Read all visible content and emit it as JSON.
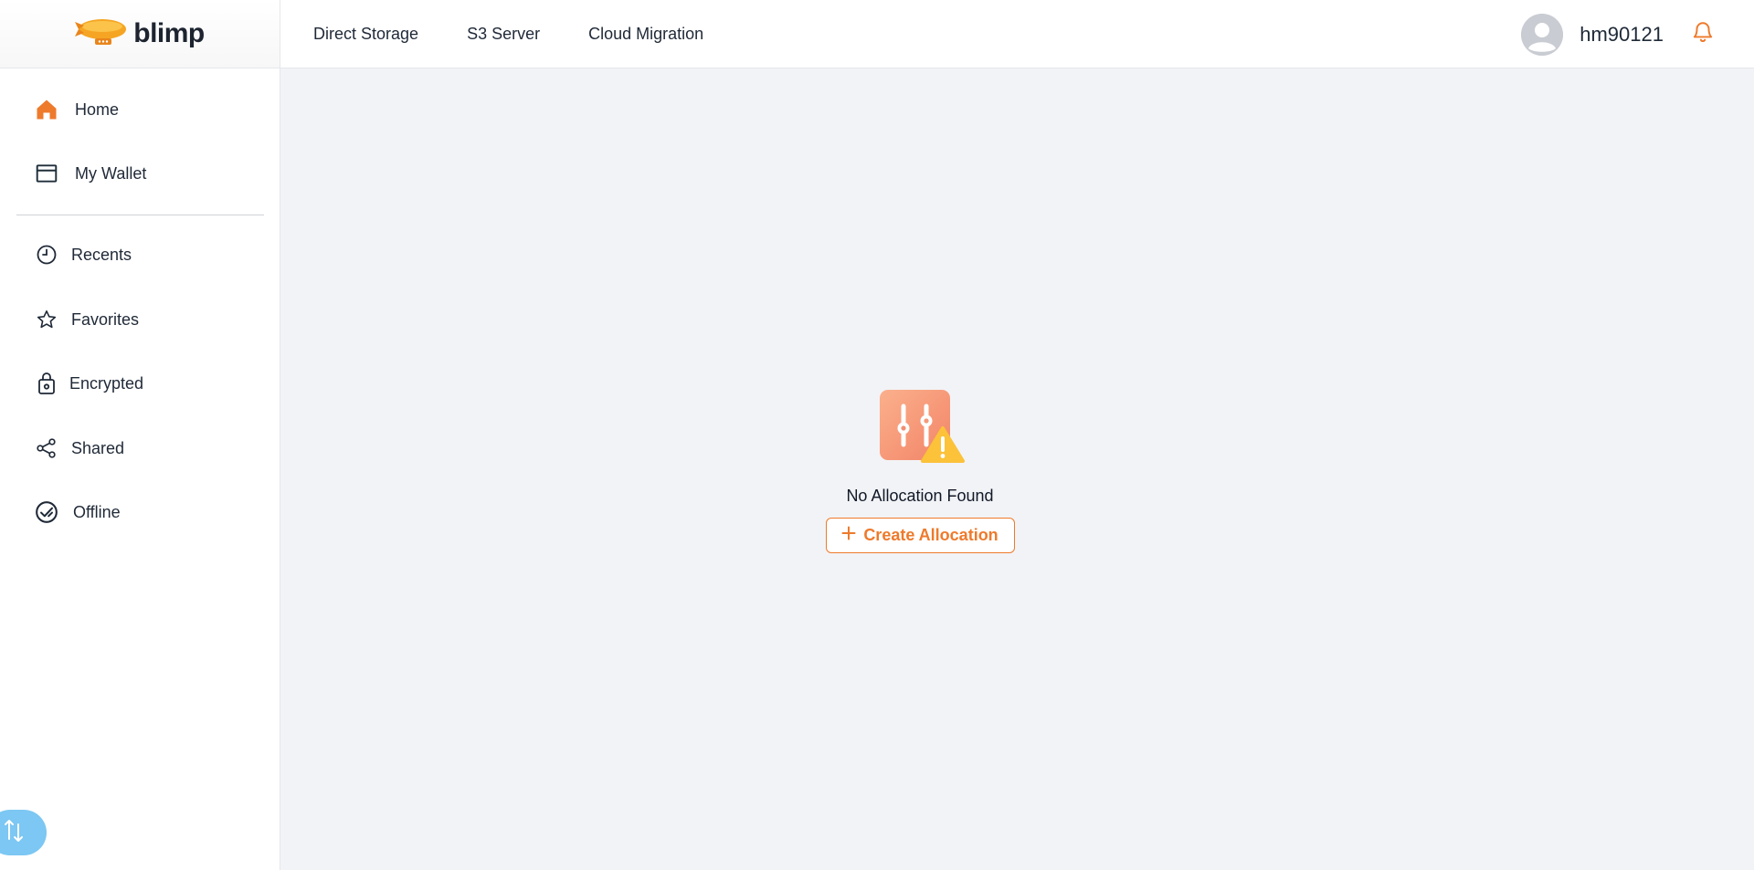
{
  "brand": {
    "name": "blimp",
    "accent": "#ee7a2b"
  },
  "topnav": {
    "items": [
      {
        "label": "Direct Storage"
      },
      {
        "label": "S3 Server"
      },
      {
        "label": "Cloud Migration"
      }
    ]
  },
  "user": {
    "username": "hm90121"
  },
  "sidebar": {
    "primary": [
      {
        "label": "Home",
        "icon": "home-icon"
      },
      {
        "label": "My Wallet",
        "icon": "wallet-icon"
      }
    ],
    "secondary": [
      {
        "label": "Recents",
        "icon": "clock-icon"
      },
      {
        "label": "Favorites",
        "icon": "star-icon"
      },
      {
        "label": "Encrypted",
        "icon": "lock-icon"
      },
      {
        "label": "Shared",
        "icon": "share-icon"
      },
      {
        "label": "Offline",
        "icon": "offline-check-icon"
      }
    ]
  },
  "empty_state": {
    "title": "No Allocation Found",
    "button_label": "Create Allocation"
  }
}
